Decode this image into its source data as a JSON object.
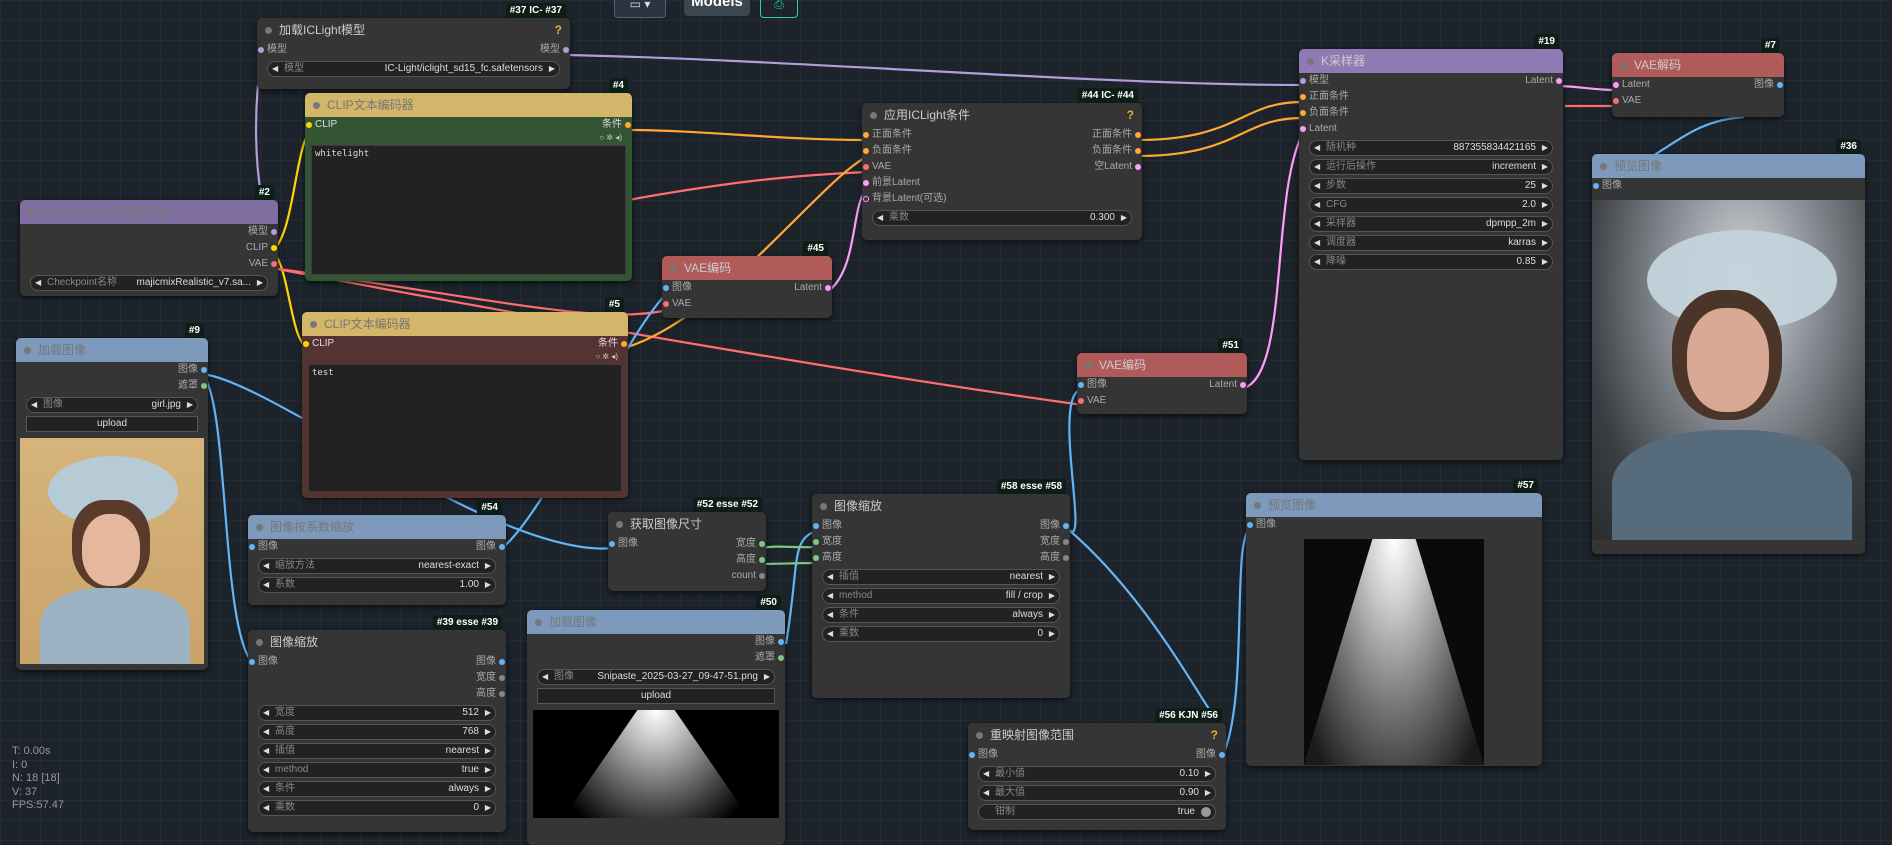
{
  "toolbar": {
    "models_label": "Models"
  },
  "colors": {
    "clip": "#ffd500",
    "conditioning": "#ffa931",
    "model": "#b39ddb",
    "vae": "#ff6e6e",
    "latent": "#ff9cf9",
    "image": "#64b5f6",
    "mask": "#81c784"
  },
  "nodes": {
    "n37": {
      "badge": "#37 IC-  #37",
      "title": "加载ICLight模型",
      "q": "?",
      "in_model": "模型",
      "out_model": "模型",
      "w_model_label": "模型",
      "w_model_value": "IC-Light/iclight_sd15_fc.safetensors"
    },
    "n4": {
      "badge": "#4",
      "title": "CLIP文本编码器",
      "in_clip": "CLIP",
      "out_cond": "条件",
      "text": "whitelight"
    },
    "n2": {
      "badge": "#2",
      "title": "Checkpoint加载器(简易)",
      "out_model": "模型",
      "out_clip": "CLIP",
      "out_vae": "VAE",
      "w_ckpt_label": "Checkpoint名称",
      "w_ckpt_value": "majicmixRealistic_v7.sa..."
    },
    "n5": {
      "badge": "#5",
      "title": "CLIP文本编码器",
      "in_clip": "CLIP",
      "out_cond": "条件",
      "text": "test"
    },
    "n9": {
      "badge": "#9",
      "title": "加载图像",
      "out_image": "图像",
      "out_mask": "遮罩",
      "w_image_label": "图像",
      "w_image_value": "girl.jpg",
      "upload": "upload"
    },
    "n45": {
      "badge": "#45",
      "title": "VAE编码",
      "in_image": "图像",
      "in_vae": "VAE",
      "out_latent": "Latent"
    },
    "n44": {
      "badge": "#44 IC-  #44",
      "title": "应用ICLight条件",
      "q": "?",
      "in_pos": "正面条件",
      "in_neg": "负面条件",
      "in_vae": "VAE",
      "in_fg": "前景Latent",
      "in_bg": "背景Latent(可选)",
      "out_pos": "正面条件",
      "out_neg": "负面条件",
      "out_empty": "空Latent",
      "w_mult_label": "乘数",
      "w_mult_value": "0.300"
    },
    "n19": {
      "badge": "#19",
      "title": "K采样器",
      "in_model": "模型",
      "in_pos": "正面条件",
      "in_neg": "负面条件",
      "in_latent": "Latent",
      "out_latent": "Latent",
      "widgets": [
        {
          "label": "随机种",
          "value": "887355834421165"
        },
        {
          "label": "运行后操作",
          "value": "increment"
        },
        {
          "label": "步数",
          "value": "25"
        },
        {
          "label": "CFG",
          "value": "2.0"
        },
        {
          "label": "采样器",
          "value": "dpmpp_2m"
        },
        {
          "label": "调度器",
          "value": "karras"
        },
        {
          "label": "降噪",
          "value": "0.85"
        }
      ]
    },
    "n7": {
      "badge": "#7",
      "title": "VAE解码",
      "in_latent": "Latent",
      "in_vae": "VAE",
      "out_image": "图像"
    },
    "n36": {
      "badge": "#36",
      "title": "预览图像",
      "in_image": "图像"
    },
    "n51": {
      "badge": "#51",
      "title": "VAE编码",
      "in_image": "图像",
      "in_vae": "VAE",
      "out_latent": "Latent"
    },
    "n54": {
      "badge": "#54",
      "title": "图像按系数缩放",
      "in_image": "图像",
      "out_image": "图像",
      "w_method_label": "缩放方法",
      "w_method_value": "nearest-exact",
      "w_factor_label": "系数",
      "w_factor_value": "1.00"
    },
    "n52": {
      "badge": "#52 esse  #52",
      "title": "获取图像尺寸",
      "in_image": "图像",
      "out_width": "宽度",
      "out_height": "高度",
      "out_count": "count"
    },
    "n58": {
      "badge": "#58 esse  #58",
      "title": "图像缩放",
      "in_image": "图像",
      "in_width": "宽度",
      "in_height": "高度",
      "out_image": "图像",
      "out_width": "宽度",
      "out_height": "高度",
      "widgets": [
        {
          "label": "插值",
          "value": "nearest"
        },
        {
          "label": "method",
          "value": "fill / crop"
        },
        {
          "label": "条件",
          "value": "always"
        },
        {
          "label": "乘数",
          "value": "0"
        }
      ]
    },
    "n39": {
      "badge": "#39 esse  #39",
      "title": "图像缩放",
      "in_image": "图像",
      "out_image": "图像",
      "out_width": "宽度",
      "out_height": "高度",
      "widgets": [
        {
          "label": "宽度",
          "value": "512"
        },
        {
          "label": "高度",
          "value": "768"
        },
        {
          "label": "插值",
          "value": "nearest"
        },
        {
          "label": "method",
          "value": "true"
        },
        {
          "label": "条件",
          "value": "always"
        },
        {
          "label": "乘数",
          "value": "0"
        }
      ]
    },
    "n50": {
      "badge": "#50",
      "title": "加载图像",
      "out_image": "图像",
      "out_mask": "遮罩",
      "w_image_label": "图像",
      "w_image_value": "Snipaste_2025-03-27_09-47-51.png",
      "upload": "upload"
    },
    "n56": {
      "badge": "#56 KJN  #56",
      "title": "重映射图像范围",
      "q": "?",
      "in_image": "图像",
      "out_image": "图像",
      "widgets": [
        {
          "label": "最小值",
          "value": "0.10"
        },
        {
          "label": "最大值",
          "value": "0.90"
        }
      ],
      "clamp_label": "钳制",
      "clamp_value": "true"
    },
    "n57": {
      "badge": "#57",
      "title": "预览图像",
      "in_image": "图像"
    }
  },
  "stats": {
    "t": "T: 0.00s",
    "i": "I: 0",
    "n": "N: 18 [18]",
    "v": "V: 37",
    "fps": "FPS:57.47"
  }
}
